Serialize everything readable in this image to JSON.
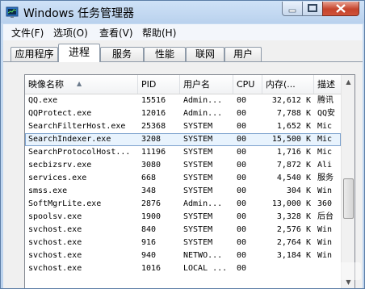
{
  "window": {
    "title": "Windows 任务管理器"
  },
  "menu": [
    "文件(F)",
    "选项(O)",
    "查看(V)",
    "帮助(H)"
  ],
  "tabs": [
    "应用程序",
    "进程",
    "服务",
    "性能",
    "联网",
    "用户"
  ],
  "active_tab": "进程",
  "columns": [
    "映像名称",
    "PID",
    "用户名",
    "CPU",
    "内存(...",
    "描述"
  ],
  "rows": [
    {
      "name": "QQ.exe",
      "pid": "15516",
      "user": "Admin...",
      "cpu": "00",
      "mem": "32,612 K",
      "desc": "腾讯"
    },
    {
      "name": "QQProtect.exe",
      "pid": "12016",
      "user": "Admin...",
      "cpu": "00",
      "mem": "7,788 K",
      "desc": "QQ安"
    },
    {
      "name": "SearchFilterHost.exe",
      "pid": "25368",
      "user": "SYSTEM",
      "cpu": "00",
      "mem": "1,652 K",
      "desc": "Mic"
    },
    {
      "name": "SearchIndexer.exe",
      "pid": "3208",
      "user": "SYSTEM",
      "cpu": "00",
      "mem": "15,500 K",
      "desc": "Mic"
    },
    {
      "name": "SearchProtocolHost...",
      "pid": "11196",
      "user": "SYSTEM",
      "cpu": "00",
      "mem": "1,716 K",
      "desc": "Mic"
    },
    {
      "name": "secbizsrv.exe",
      "pid": "3080",
      "user": "SYSTEM",
      "cpu": "00",
      "mem": "7,872 K",
      "desc": "Ali"
    },
    {
      "name": "services.exe",
      "pid": "668",
      "user": "SYSTEM",
      "cpu": "00",
      "mem": "4,540 K",
      "desc": "服务"
    },
    {
      "name": "smss.exe",
      "pid": "348",
      "user": "SYSTEM",
      "cpu": "00",
      "mem": "304 K",
      "desc": "Win"
    },
    {
      "name": "SoftMgrLite.exe",
      "pid": "2876",
      "user": "Admin...",
      "cpu": "00",
      "mem": "13,000 K",
      "desc": "360"
    },
    {
      "name": "spoolsv.exe",
      "pid": "1900",
      "user": "SYSTEM",
      "cpu": "00",
      "mem": "3,328 K",
      "desc": "后台"
    },
    {
      "name": "svchost.exe",
      "pid": "840",
      "user": "SYSTEM",
      "cpu": "00",
      "mem": "2,576 K",
      "desc": "Win"
    },
    {
      "name": "svchost.exe",
      "pid": "916",
      "user": "SYSTEM",
      "cpu": "00",
      "mem": "2,764 K",
      "desc": "Win"
    },
    {
      "name": "svchost.exe",
      "pid": "940",
      "user": "NETWO...",
      "cpu": "00",
      "mem": "3,184 K",
      "desc": "Win"
    },
    {
      "name": "svchost.exe",
      "pid": "1016",
      "user": "LOCAL ...",
      "cpu": "00",
      "mem": "",
      "desc": ""
    }
  ],
  "selected_row": 3,
  "colors": {
    "accent": "#7da2ce",
    "close": "#c5432c",
    "selection": "#e8f3fd"
  },
  "icons": [
    "task-manager-icon",
    "minimize-icon",
    "maximize-icon",
    "close-icon",
    "sort-ascending-icon",
    "scroll-up-icon",
    "scroll-down-icon",
    "watermark-logo"
  ]
}
